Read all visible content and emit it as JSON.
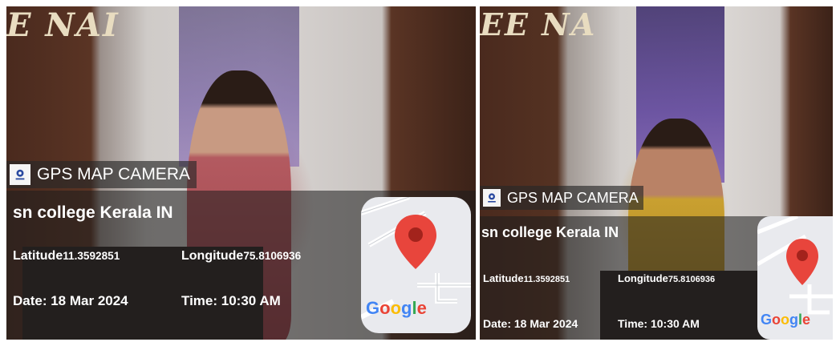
{
  "photos": [
    {
      "banner": "E NAI",
      "app_label": "GPS MAP CAMERA",
      "location": "sn college  Kerala IN",
      "latitude_label": "Latitude",
      "latitude_value": "11.3592851",
      "longitude_label": "Longitude",
      "longitude_value": "75.8106936",
      "date": "Date: 18 Mar 2024",
      "time": "Time: 10:30 AM",
      "map_brand": "Google"
    },
    {
      "banner": "EE NA",
      "app_label": "GPS MAP CAMERA",
      "location": "sn college  Kerala IN",
      "latitude_label": "Latitude",
      "latitude_value": "11.3592851",
      "longitude_label": "Longitude",
      "longitude_value": "75.8106936",
      "date": "Date: 18 Mar 2024",
      "time": "Time: 10:30 AM",
      "map_brand": "Google"
    }
  ],
  "colors": {
    "pin_red": "#e8453c",
    "google_blue": "#4285f4",
    "google_red": "#ea4335",
    "google_yellow": "#fbbc05",
    "google_green": "#34a853"
  }
}
